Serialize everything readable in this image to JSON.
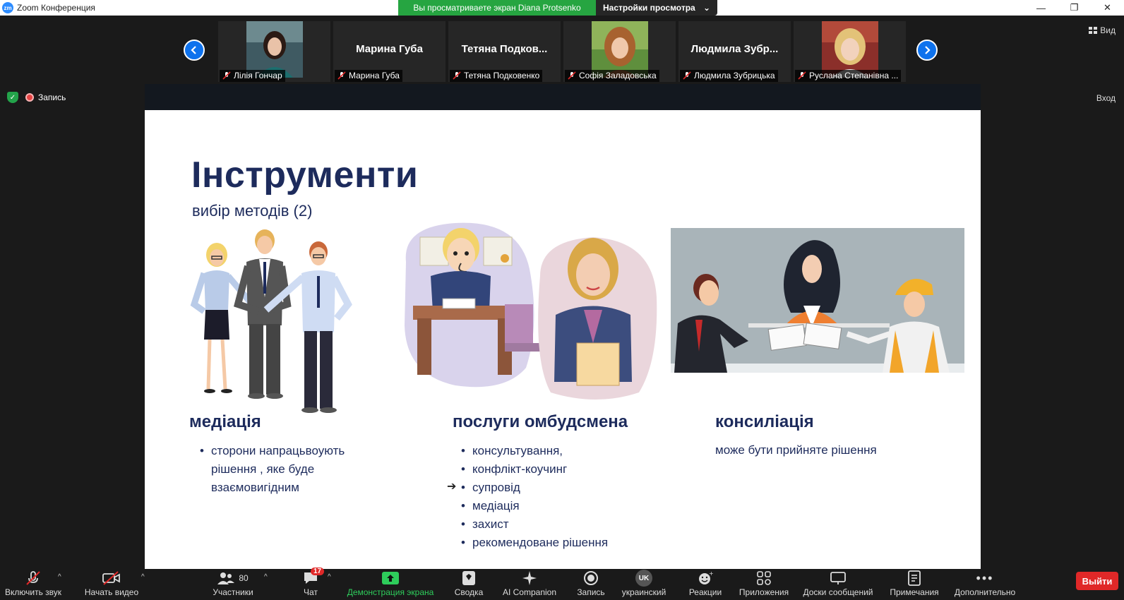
{
  "window": {
    "app_title": "Zoom Конференция",
    "logo_text": "zm",
    "share_banner_text": "Вы просматриваете экран Diana Protsenko",
    "view_settings_label": "Настройки просмотра",
    "view_label": "Вид",
    "enter_label": "Вход",
    "recording_label": "Запись"
  },
  "participants": [
    {
      "name": "Лілія Гончар",
      "display": "photo"
    },
    {
      "name": "Марина Губа",
      "display": "name",
      "big_name": "Марина Губа"
    },
    {
      "name": "Тетяна Подковенко",
      "display": "name",
      "big_name": "Тетяна  Подков..."
    },
    {
      "name": "Софія Заладовська",
      "display": "photo"
    },
    {
      "name": "Людмила Зубрицька",
      "display": "name",
      "big_name": "Людмила  Зубр..."
    },
    {
      "name": "Руслана Степанівна ...",
      "display": "photo"
    }
  ],
  "slide": {
    "title": "Інструменти",
    "subtitle": "вибір методів (2)",
    "columns": [
      {
        "heading": "медіація",
        "bullets": [
          "сторони напрацьвоують рішення , яке буде взаємовигідним"
        ]
      },
      {
        "heading": "послуги омбудсмена",
        "bullets": [
          "консультування,",
          "конфлікт-коучинг",
          "супровід",
          "медіація",
          "захист",
          "рекомендоване рішення"
        ]
      },
      {
        "heading": "консиліація",
        "text": "може бути прийняте рішення"
      }
    ]
  },
  "toolbar": {
    "audio": "Включить звук",
    "video": "Начать видео",
    "participants": "Участники",
    "participants_count": "80",
    "chat": "Чат",
    "chat_badge": "17",
    "share": "Демонстрация экрана",
    "summary": "Сводка",
    "ai": "AI Companion",
    "record": "Запись",
    "language": "украинский",
    "language_code": "UK",
    "reactions": "Реакции",
    "apps": "Приложения",
    "whiteboards": "Доски сообщений",
    "notes": "Примечания",
    "more": "Дополнительно",
    "exit": "Выйти"
  },
  "colors": {
    "zoom_blue": "#0e72ed",
    "share_green": "#26a541",
    "exit_red": "#e02828",
    "slide_navy": "#1d2b5c"
  }
}
